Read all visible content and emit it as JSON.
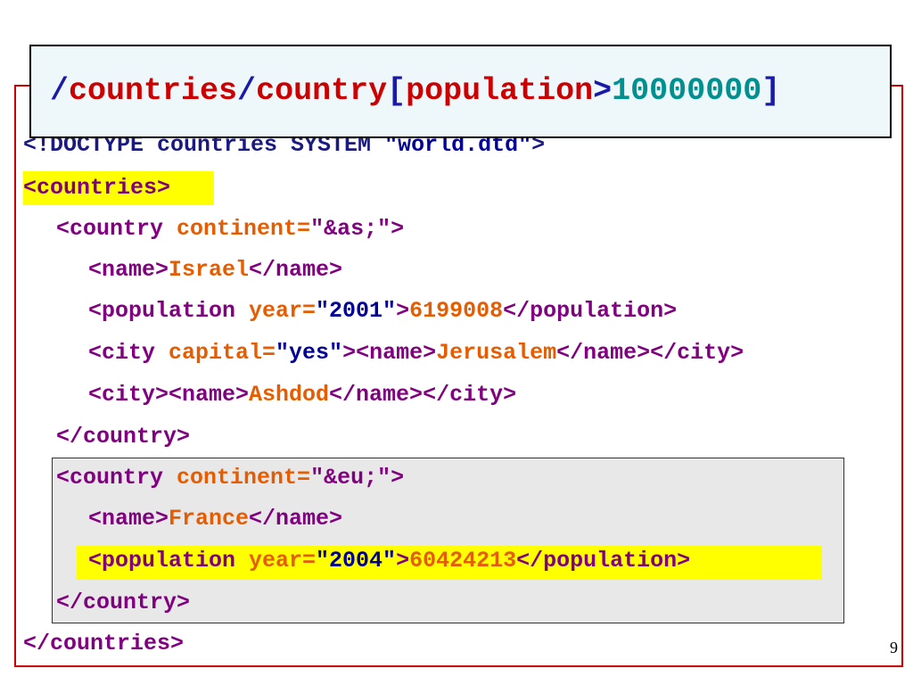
{
  "xpath": {
    "slash1": "/",
    "step1": "countries",
    "slash2": "/",
    "step2": "country",
    "bracket_open": "[",
    "predicate": "population",
    "op": ">",
    "value": "10000000",
    "bracket_close": "]"
  },
  "lines": {
    "doctype_a": "<!DOCTYPE countries SYSTEM ",
    "doctype_b": "\"world.dtd\"",
    "doctype_c": ">",
    "countries_open": "<countries>",
    "c1_tag": "<country ",
    "c1_attr": "continent=",
    "c1_val": "\"&as;\"",
    "c1_close": ">",
    "n1_open": "<name>",
    "n1_text": "Israel",
    "n1_close": "</name>",
    "p1_tag": "<population ",
    "p1_attr": "year=",
    "p1_val": "\"2001\"",
    "p1_gt": ">",
    "p1_text": "6199008",
    "p1_close": "</population>",
    "city1_tag": "<city ",
    "city1_attr": "capital=",
    "city1_val": "\"yes\"",
    "city1_gt": "><name>",
    "city1_text": "Jerusalem",
    "city1_close": "</name></city>",
    "city2_open": "<city><name>",
    "city2_text": "Ashdod",
    "city2_close": "</name></city>",
    "c1_end": "</country>",
    "c2_tag": "<country ",
    "c2_attr": "continent=",
    "c2_val": "\"&eu;\"",
    "c2_close": ">",
    "n2_open": "<name>",
    "n2_text": "France",
    "n2_close": "</name>",
    "p2_tag": "<population ",
    "p2_attr": "year=",
    "p2_val": "\"2004\"",
    "p2_gt": ">",
    "p2_text": "60424213",
    "p2_close": "</population>",
    "c2_end": "</country>",
    "countries_close": "</countries>"
  },
  "page_number": "9"
}
